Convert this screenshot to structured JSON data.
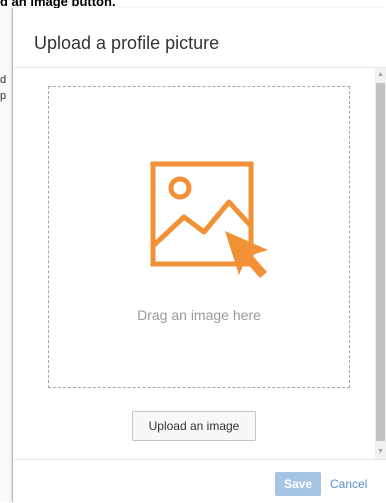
{
  "page": {
    "instruction_text": "d an image button."
  },
  "background": {
    "fragments": [
      "d",
      "p"
    ]
  },
  "dialog": {
    "title": "Upload a profile picture",
    "dropzone": {
      "text": "Drag an image here",
      "icon": "image-drop-icon",
      "accent_color": "#f29035"
    },
    "upload_button": "Upload an image",
    "save_button": "Save",
    "cancel_link": "Cancel"
  }
}
